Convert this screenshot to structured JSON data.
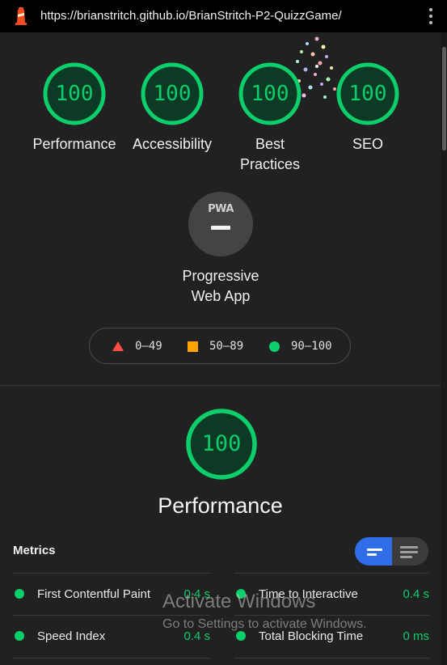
{
  "browser": {
    "url": "https://brianstritch.github.io/BrianStritch-P2-QuizzGame/",
    "logo_icon": "lighthouse-icon",
    "menu_icon": "kebab-menu-icon"
  },
  "summary_scores": [
    {
      "label": "Performance",
      "score": "100"
    },
    {
      "label": "Accessibility",
      "score": "100"
    },
    {
      "label": "Best Practices",
      "label_line1": "Best",
      "label_line2": "Practices",
      "score": "100"
    },
    {
      "label": "SEO",
      "score": "100"
    }
  ],
  "pwa": {
    "badge_text": "PWA",
    "label_line1": "Progressive",
    "label_line2": "Web App"
  },
  "legend": [
    {
      "range": "0–49",
      "shape": "triangle",
      "color": "#ff4e42"
    },
    {
      "range": "50–89",
      "shape": "square",
      "color": "#ffa400"
    },
    {
      "range": "90–100",
      "shape": "circle",
      "color": "#0cce6b"
    }
  ],
  "performance": {
    "score": "100",
    "title": "Performance",
    "metrics_title": "Metrics",
    "metrics": [
      {
        "name": "First Contentful Paint",
        "value": "0.4 s"
      },
      {
        "name": "Time to Interactive",
        "value": "0.4 s"
      },
      {
        "name": "Speed Index",
        "value": "0.4 s"
      },
      {
        "name": "Total Blocking Time",
        "value": "0 ms"
      }
    ]
  },
  "watermark": {
    "line1": "Activate Windows",
    "line2": "Go to Settings to activate Windows."
  },
  "colors": {
    "pass": "#0cce6b",
    "average": "#ffa400",
    "fail": "#ff4e42",
    "toggle_active": "#2f6ee8",
    "background": "#212121"
  }
}
